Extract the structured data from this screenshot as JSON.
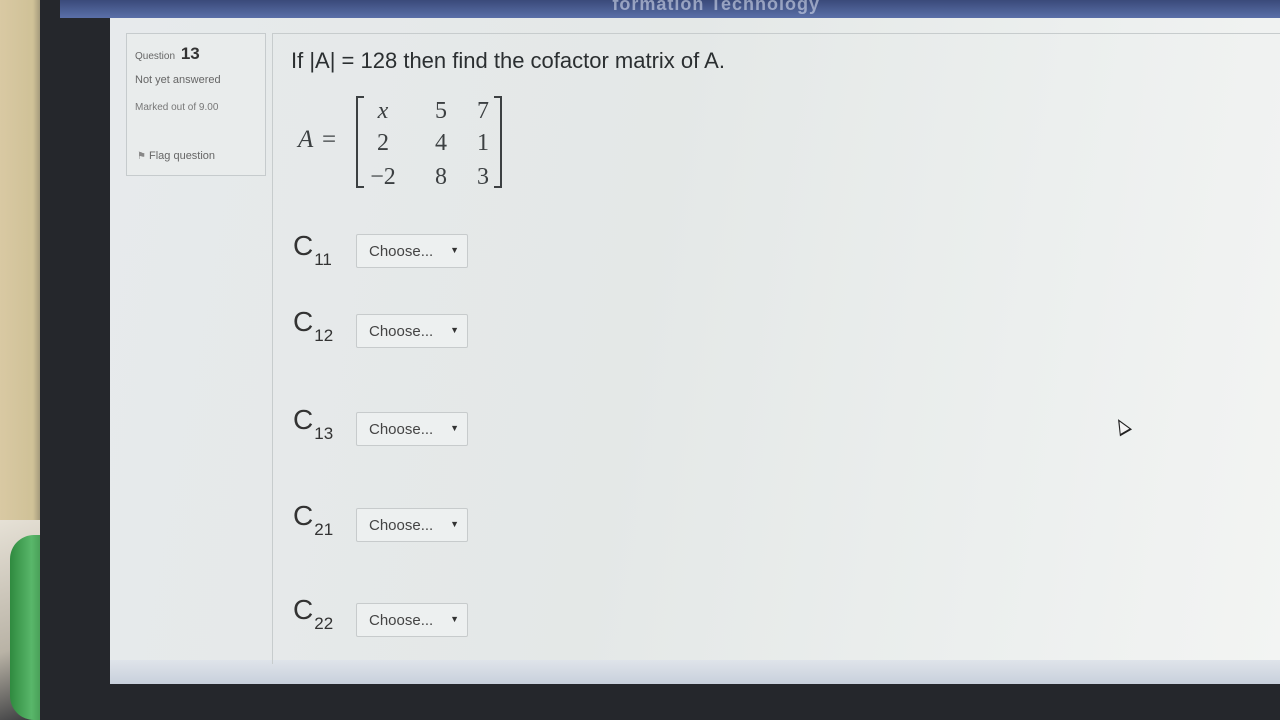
{
  "header": {
    "banner_fragment": "formation Technology"
  },
  "question_info": {
    "label": "Question",
    "number": "13",
    "state": "Not yet answered",
    "marked": "Marked out of 9.00",
    "flag_label": "Flag question"
  },
  "question_text": "If |A| = 128 then find the cofactor matrix of A.",
  "matrix": {
    "name": "A",
    "equals": "=",
    "rows": [
      [
        "x",
        "5",
        "7"
      ],
      [
        "2",
        "4",
        "1"
      ],
      [
        "−2",
        "8",
        "3"
      ]
    ]
  },
  "cofactors": [
    {
      "label": "C",
      "sub": "11",
      "value": "Choose..."
    },
    {
      "label": "C",
      "sub": "12",
      "value": "Choose..."
    },
    {
      "label": "C",
      "sub": "13",
      "value": "Choose..."
    },
    {
      "label": "C",
      "sub": "21",
      "value": "Choose..."
    },
    {
      "label": "C",
      "sub": "22",
      "value": "Choose..."
    }
  ]
}
